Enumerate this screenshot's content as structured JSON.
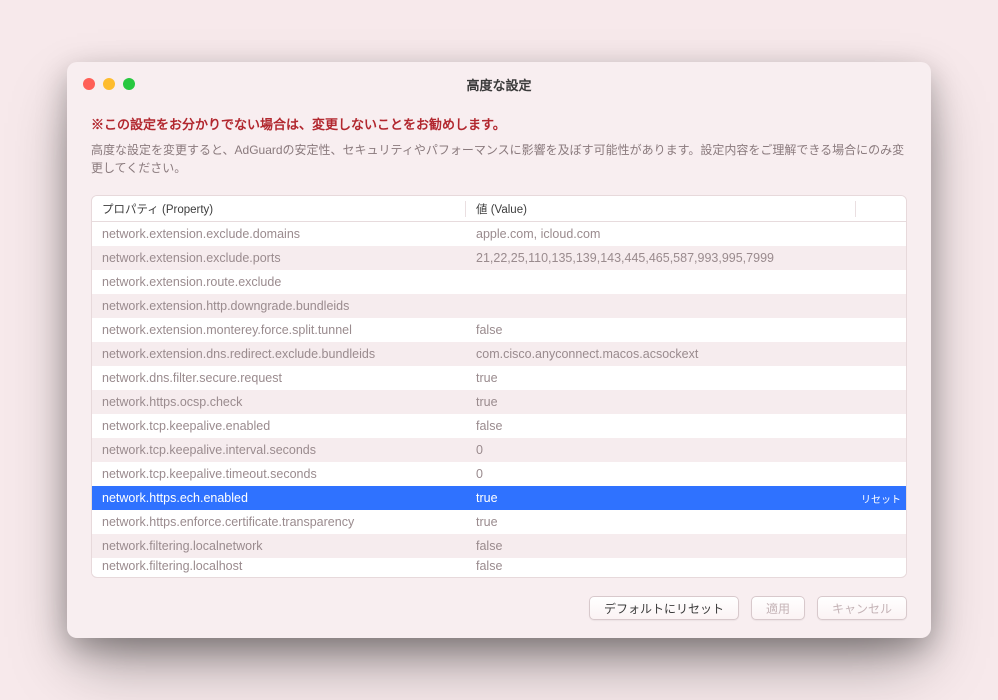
{
  "window": {
    "title": "高度な設定"
  },
  "header": {
    "warning": "※この設定をお分かりでない場合は、変更しないことをお勧めします。",
    "sub": "高度な設定を変更すると、AdGuardの安定性、セキュリティやパフォーマンスに影響を及ぼす可能性があります。設定内容をご理解できる場合にのみ変更してください。"
  },
  "columns": {
    "property": "プロパティ (Property)",
    "value": "値 (Value)"
  },
  "selected_index": 11,
  "selected_action_label": "リセット",
  "rows": [
    {
      "property": "network.extension.exclude.domains",
      "value": "apple.com, icloud.com"
    },
    {
      "property": "network.extension.exclude.ports",
      "value": "21,22,25,110,135,139,143,445,465,587,993,995,7999"
    },
    {
      "property": "network.extension.route.exclude",
      "value": ""
    },
    {
      "property": "network.extension.http.downgrade.bundleids",
      "value": ""
    },
    {
      "property": "network.extension.monterey.force.split.tunnel",
      "value": "false"
    },
    {
      "property": "network.extension.dns.redirect.exclude.bundleids",
      "value": "com.cisco.anyconnect.macos.acsockext"
    },
    {
      "property": "network.dns.filter.secure.request",
      "value": "true"
    },
    {
      "property": "network.https.ocsp.check",
      "value": "true"
    },
    {
      "property": "network.tcp.keepalive.enabled",
      "value": "false"
    },
    {
      "property": "network.tcp.keepalive.interval.seconds",
      "value": "0"
    },
    {
      "property": "network.tcp.keepalive.timeout.seconds",
      "value": "0"
    },
    {
      "property": "network.https.ech.enabled",
      "value": "true"
    },
    {
      "property": "network.https.enforce.certificate.transparency",
      "value": "true"
    },
    {
      "property": "network.filtering.localnetwork",
      "value": "false"
    },
    {
      "property": "network.filtering.localhost",
      "value": "false"
    }
  ],
  "buttons": {
    "reset_defaults": "デフォルトにリセット",
    "apply": "適用",
    "cancel": "キャンセル"
  }
}
